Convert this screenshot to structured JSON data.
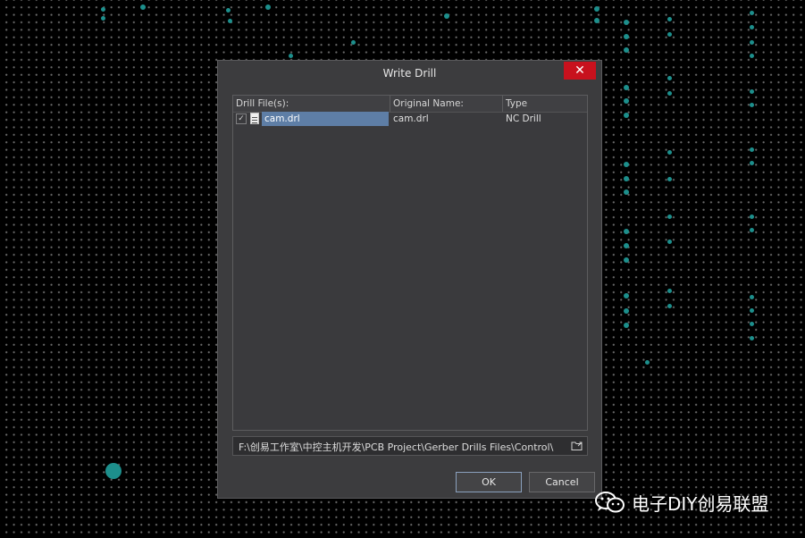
{
  "dialog": {
    "title": "Write Drill",
    "close_label": "✕"
  },
  "list": {
    "columns": [
      "Drill File(s):",
      "Original Name:",
      "Type"
    ],
    "rows": [
      {
        "checked": true,
        "drill_file": "cam.drl",
        "original_name": "cam.drl",
        "type": "NC Drill"
      }
    ]
  },
  "path": {
    "value": "F:\\创易工作室\\中控主机开发\\PCB Project\\Gerber Drills Files\\Control\\"
  },
  "buttons": {
    "ok": "OK",
    "cancel": "Cancel"
  },
  "watermark": {
    "text": "电子DIY创易联盟"
  },
  "colors": {
    "pad": "#1d8f8c",
    "selection": "#5e7ea6",
    "close": "#c8111d"
  }
}
